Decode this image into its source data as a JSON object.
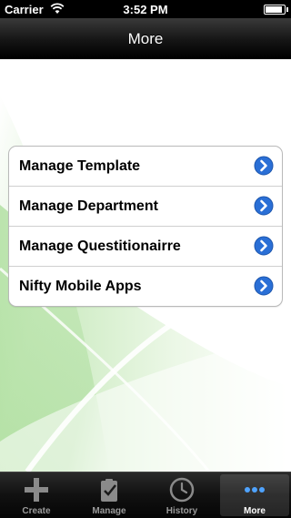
{
  "status_bar": {
    "carrier": "Carrier",
    "time": "3:52 PM"
  },
  "nav_bar": {
    "title": "More"
  },
  "menu": {
    "items": [
      {
        "label": "Manage Template"
      },
      {
        "label": "Manage Department"
      },
      {
        "label": "Manage Questitionairre"
      },
      {
        "label": "Nifty Mobile Apps"
      }
    ]
  },
  "tab_bar": {
    "tabs": [
      {
        "label": "Create",
        "icon": "plus-icon"
      },
      {
        "label": "Manage",
        "icon": "clipboard-check-icon"
      },
      {
        "label": "History",
        "icon": "clock-icon"
      },
      {
        "label": "More",
        "icon": "more-dots-icon",
        "selected": true
      }
    ]
  },
  "colors": {
    "accent": "#2a6fd6",
    "background_green": "#8fd07e"
  }
}
